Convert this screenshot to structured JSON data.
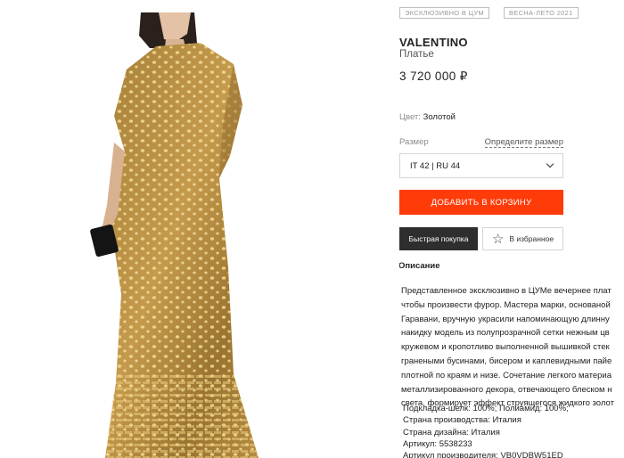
{
  "badges": [
    "ЭКСКЛЮЗИВНО В ЦУМ",
    "ВЕСНА-ЛЕТО 2021"
  ],
  "product": {
    "brand": "VALENTINO",
    "type": "Платье",
    "price": "3 720 000 ₽",
    "color_label": "Цвет:",
    "color_value": "Золотой"
  },
  "size": {
    "label": "Размер",
    "guide_link": "Определите размер",
    "selected": "IT 42 | RU 44"
  },
  "buttons": {
    "add_to_cart": "ДОБАВИТЬ В КОРЗИНУ",
    "quick_buy": "Быстрая покупка",
    "favorites": "В избранное"
  },
  "description": {
    "heading": "Описание",
    "lines": [
      "Представленное эксклюзивно в ЦУМе вечернее плат",
      "чтобы произвести фурор. Мастера марки, основаной",
      "Гаравани, вручную украсили напоминающую длинну",
      "накидку модель из полупрозрачной сетки нежным цв",
      "кружевом и кропотливо выполненной вышивкой стек",
      "гранеными бусинами, бисером и каплевидными пайе",
      "плотной по краям и низе. Сочетание легкого материа",
      "металлизированного декора, отвечающего блеском н",
      "света, формирует эффект струящегося жидкого золот"
    ]
  },
  "specs": [
    "Подкладка-шелк: 100%; Полиамид: 100%;",
    "Страна производства: Италия",
    "Страна дизайна: Италия",
    "Артикул: 5538233",
    "Артикул производителя: VB0VDBW51ED"
  ],
  "colors": {
    "accent": "#ff3b0a",
    "dark_button": "#2e2e2e",
    "dress_gold": "#b8903e"
  },
  "icons": {
    "size_select": "chevron-down-icon",
    "favorites": "star-outline-icon",
    "description_toggle": "chevron-up-icon"
  }
}
